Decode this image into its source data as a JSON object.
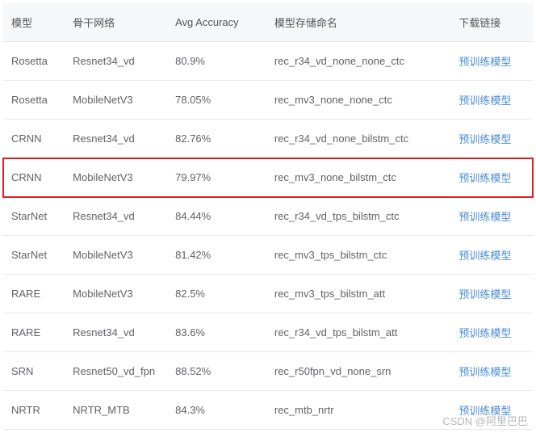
{
  "headers": {
    "model": "模型",
    "backbone": "骨干网络",
    "accuracy": "Avg Accuracy",
    "storage": "模型存储命名",
    "link": "下载链接"
  },
  "link_text": "预训练模型",
  "rows": [
    {
      "model": "Rosetta",
      "backbone": "Resnet34_vd",
      "accuracy": "80.9%",
      "storage": "rec_r34_vd_none_none_ctc",
      "highlighted": false
    },
    {
      "model": "Rosetta",
      "backbone": "MobileNetV3",
      "accuracy": "78.05%",
      "storage": "rec_mv3_none_none_ctc",
      "highlighted": false
    },
    {
      "model": "CRNN",
      "backbone": "Resnet34_vd",
      "accuracy": "82.76%",
      "storage": "rec_r34_vd_none_bilstm_ctc",
      "highlighted": false
    },
    {
      "model": "CRNN",
      "backbone": "MobileNetV3",
      "accuracy": "79.97%",
      "storage": "rec_mv3_none_bilstm_ctc",
      "highlighted": true
    },
    {
      "model": "StarNet",
      "backbone": "Resnet34_vd",
      "accuracy": "84.44%",
      "storage": "rec_r34_vd_tps_bilstm_ctc",
      "highlighted": false
    },
    {
      "model": "StarNet",
      "backbone": "MobileNetV3",
      "accuracy": "81.42%",
      "storage": "rec_mv3_tps_bilstm_ctc",
      "highlighted": false
    },
    {
      "model": "RARE",
      "backbone": "MobileNetV3",
      "accuracy": "82.5%",
      "storage": "rec_mv3_tps_bilstm_att",
      "highlighted": false
    },
    {
      "model": "RARE",
      "backbone": "Resnet34_vd",
      "accuracy": "83.6%",
      "storage": "rec_r34_vd_tps_bilstm_att",
      "highlighted": false
    },
    {
      "model": "SRN",
      "backbone": "Resnet50_vd_fpn",
      "accuracy": "88.52%",
      "storage": "rec_r50fpn_vd_none_srn",
      "highlighted": false
    },
    {
      "model": "NRTR",
      "backbone": "NRTR_MTB",
      "accuracy": "84.3%",
      "storage": "rec_mtb_nrtr",
      "highlighted": false
    }
  ],
  "watermark": "CSDN @阿里巴巴"
}
